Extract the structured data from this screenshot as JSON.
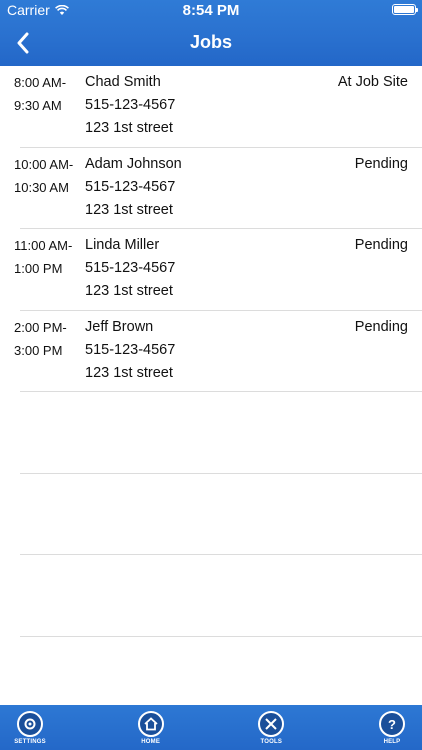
{
  "status_bar": {
    "carrier": "Carrier",
    "time": "8:54 PM"
  },
  "nav": {
    "title": "Jobs",
    "back_icon": "chevron-left-icon"
  },
  "jobs": [
    {
      "time_start": "8:00 AM-",
      "time_end": "9:30 AM",
      "name": "Chad Smith",
      "phone": "515-123-4567",
      "address": "123 1st street",
      "status": "At Job Site"
    },
    {
      "time_start": "10:00 AM-",
      "time_end": "10:30 AM",
      "name": "Adam Johnson",
      "phone": "515-123-4567",
      "address": "123 1st street",
      "status": "Pending"
    },
    {
      "time_start": "11:00 AM-",
      "time_end": "1:00 PM",
      "name": "Linda Miller",
      "phone": "515-123-4567",
      "address": "123 1st street",
      "status": "Pending"
    },
    {
      "time_start": "2:00 PM-",
      "time_end": "3:00 PM",
      "name": "Jeff Brown",
      "phone": "515-123-4567",
      "address": "123 1st street",
      "status": "Pending"
    }
  ],
  "tabs": [
    {
      "label": "SETTINGS",
      "icon": "settings-icon"
    },
    {
      "label": "HOME",
      "icon": "home-icon"
    },
    {
      "label": "TOOLS",
      "icon": "tools-icon"
    },
    {
      "label": "HELP",
      "icon": "help-icon"
    }
  ],
  "colors": {
    "header_blue": "#2a71cf",
    "separator": "#dcdcdc"
  }
}
